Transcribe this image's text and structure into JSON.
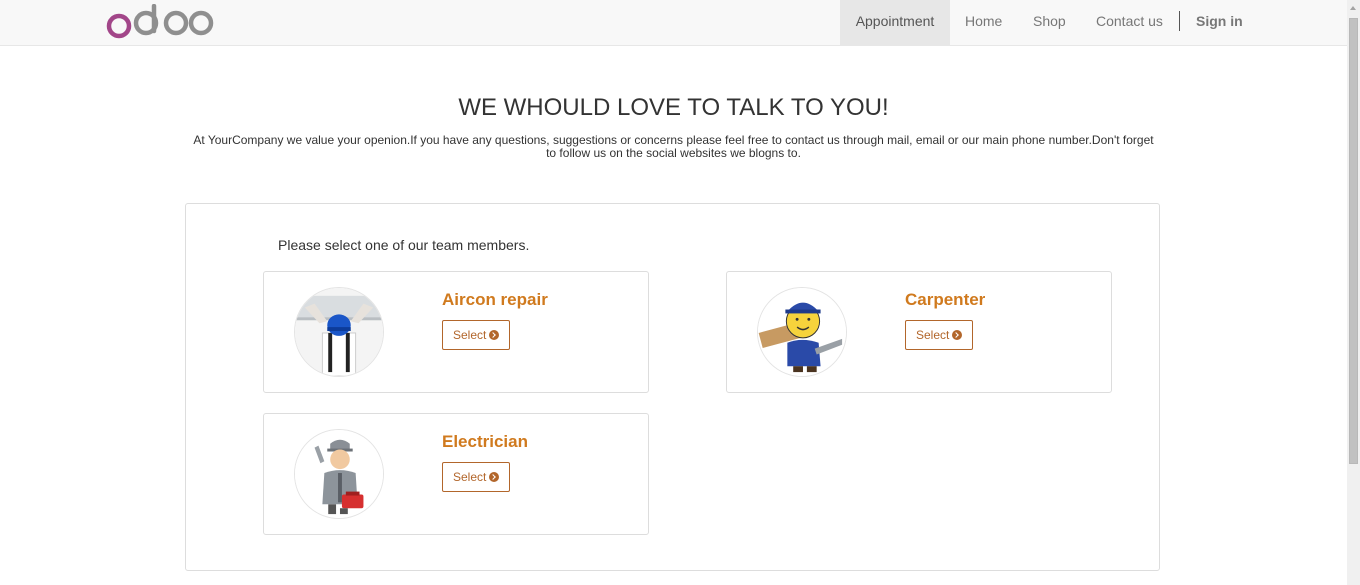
{
  "brand": {
    "logo_text": "odoo",
    "colors": {
      "o_purple": "#a24689",
      "grey": "#8f8f8f"
    }
  },
  "nav": {
    "items": [
      {
        "label": "Appointment",
        "active": true
      },
      {
        "label": "Home"
      },
      {
        "label": "Shop"
      },
      {
        "label": "Contact us"
      }
    ],
    "signin_label": "Sign in"
  },
  "hero": {
    "title": "WE WHOULD LOVE TO TALK TO YOU!",
    "intro": "At YourCompany we value your openion.If you have any questions, suggestions or concerns please feel free to contact us through mail, email or our main phone number.Don't forget to follow us on the social websites we blogns to."
  },
  "selection": {
    "prompt": "Please select one of our team members.",
    "members": [
      {
        "name": "Aircon repair",
        "button_label": "Select",
        "icon": "aircon-worker-icon"
      },
      {
        "name": "Carpenter",
        "button_label": "Select",
        "icon": "carpenter-icon"
      },
      {
        "name": "Electrician",
        "button_label": "Select",
        "icon": "electrician-icon"
      }
    ]
  },
  "colors": {
    "accent": "#d07a1e",
    "button_border": "#b2662b",
    "navbar_bg": "#f8f8f8"
  }
}
